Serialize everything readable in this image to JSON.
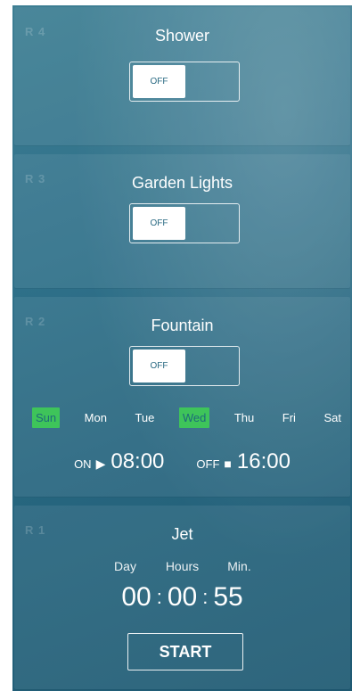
{
  "cards": {
    "r4": {
      "label": "R 4",
      "title": "Shower",
      "toggle_state": "OFF"
    },
    "r3": {
      "label": "R 3",
      "title": "Garden Lights",
      "toggle_state": "OFF"
    },
    "r2": {
      "label": "R 2",
      "title": "Fountain",
      "toggle_state": "OFF",
      "days": [
        {
          "label": "Sun",
          "active": true
        },
        {
          "label": "Mon",
          "active": false
        },
        {
          "label": "Tue",
          "active": false
        },
        {
          "label": "Wed",
          "active": true
        },
        {
          "label": "Thu",
          "active": false
        },
        {
          "label": "Fri",
          "active": false
        },
        {
          "label": "Sat",
          "active": false
        }
      ],
      "on_label": "ON",
      "on_icon": "▶",
      "on_time": "08:00",
      "off_label": "OFF",
      "off_icon": "■",
      "off_time": "16:00"
    },
    "r1": {
      "label": "R 1",
      "title": "Jet",
      "heads": {
        "day": "Day",
        "hours": "Hours",
        "min": "Min."
      },
      "values": {
        "day": "00",
        "hours": "00",
        "min": "55"
      },
      "separator": ":",
      "start_label": "START"
    }
  },
  "colors": {
    "active_day": "#3ec45a",
    "background": "#2f7089"
  }
}
